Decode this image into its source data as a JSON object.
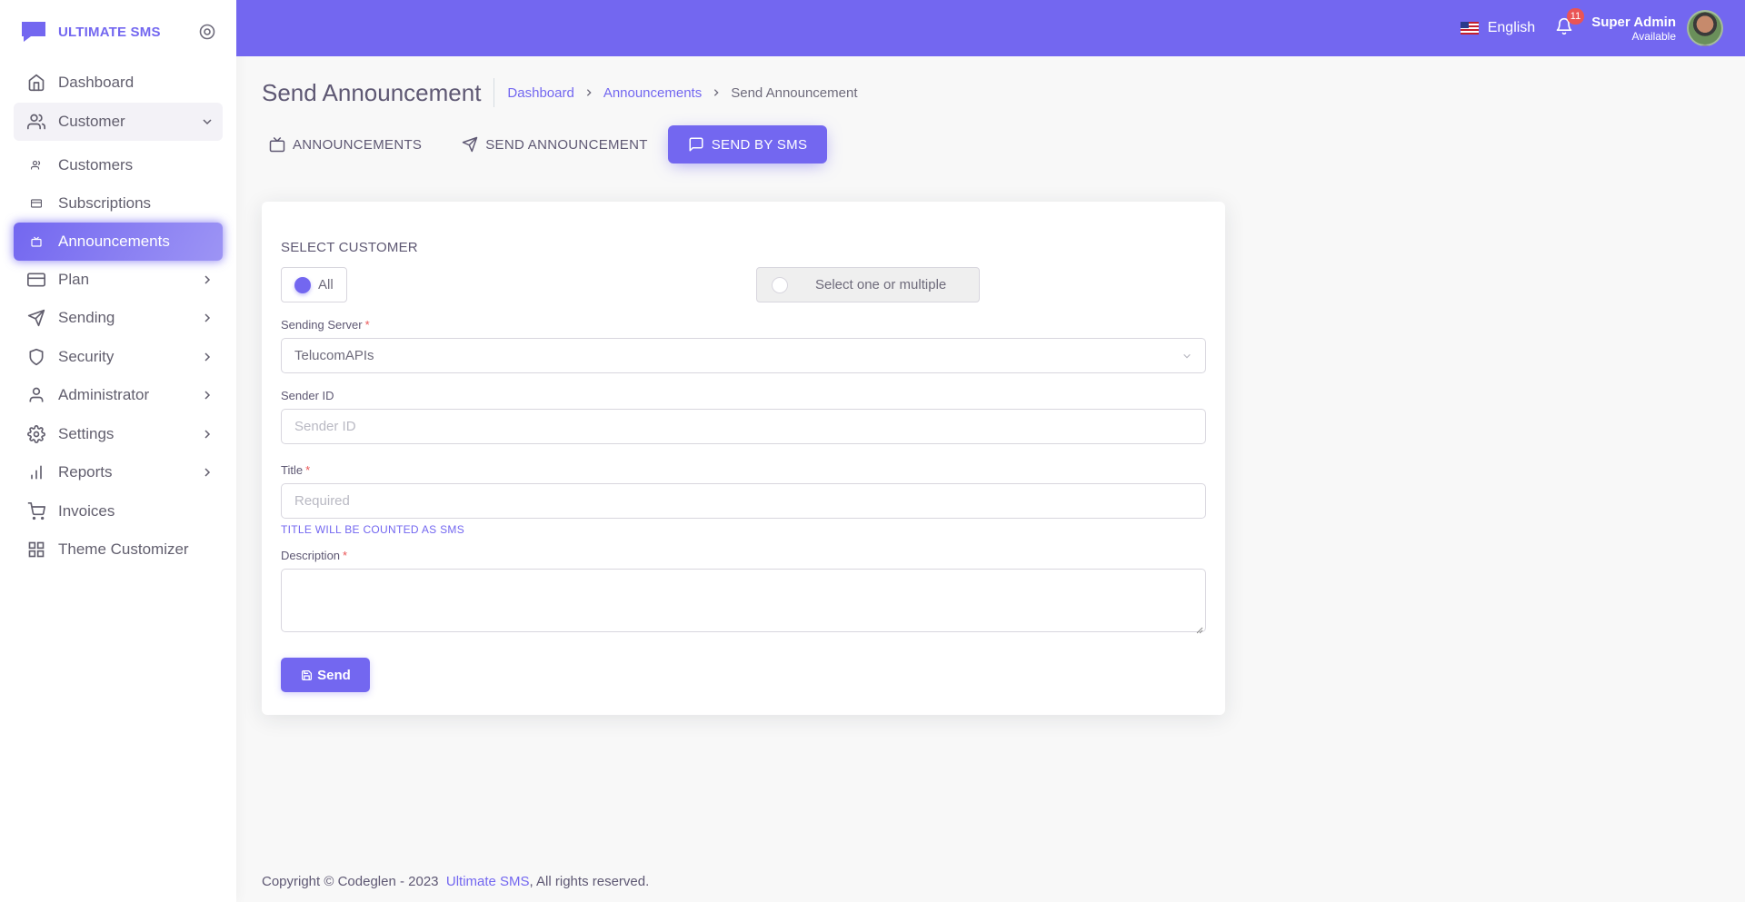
{
  "brand": {
    "name": "ULTIMATE SMS"
  },
  "sidebar": {
    "items": [
      {
        "label": "Dashboard",
        "icon": "home-icon"
      },
      {
        "label": "Customer",
        "icon": "users-icon",
        "expanded": true
      },
      {
        "label": "Customers",
        "icon": "users-small-icon",
        "sub": true
      },
      {
        "label": "Subscriptions",
        "icon": "card-small-icon",
        "sub": true
      },
      {
        "label": "Announcements",
        "icon": "tv-small-icon",
        "sub": true,
        "active": true
      },
      {
        "label": "Plan",
        "icon": "credit-card-icon"
      },
      {
        "label": "Sending",
        "icon": "send-icon"
      },
      {
        "label": "Security",
        "icon": "shield-icon"
      },
      {
        "label": "Administrator",
        "icon": "user-icon"
      },
      {
        "label": "Settings",
        "icon": "gear-icon"
      },
      {
        "label": "Reports",
        "icon": "bar-chart-icon"
      },
      {
        "label": "Invoices",
        "icon": "cart-icon"
      },
      {
        "label": "Theme Customizer",
        "icon": "grid-icon"
      }
    ]
  },
  "header": {
    "language": "English",
    "notifications_count": "11",
    "user_name": "Super Admin",
    "user_status": "Available",
    "accent_color": "#7367f0"
  },
  "page": {
    "title": "Send Announcement",
    "breadcrumb": [
      "Dashboard",
      "Announcements",
      "Send Announcement"
    ]
  },
  "tabs": [
    {
      "label": "ANNOUNCEMENTS",
      "icon": "tv-icon"
    },
    {
      "label": "SEND ANNOUNCEMENT",
      "icon": "send-icon"
    },
    {
      "label": "SEND BY SMS",
      "icon": "message-square-icon",
      "active": true
    }
  ],
  "form": {
    "select_customer_label": "SELECT CUSTOMER",
    "option_all": "All",
    "option_multiple": "Select one or multiple",
    "sending_server_label": "Sending Server",
    "sending_server_value": "TelucomAPIs",
    "sender_id_label": "Sender ID",
    "sender_id_placeholder": "Sender ID",
    "title_label": "Title",
    "title_placeholder": "Required",
    "title_hint": "TITLE WILL BE COUNTED AS SMS",
    "description_label": "Description",
    "send_button": "Send"
  },
  "footer": {
    "copyright": "Copyright © Codeglen - 2023",
    "link": "Ultimate SMS",
    "suffix": ", All rights reserved."
  }
}
